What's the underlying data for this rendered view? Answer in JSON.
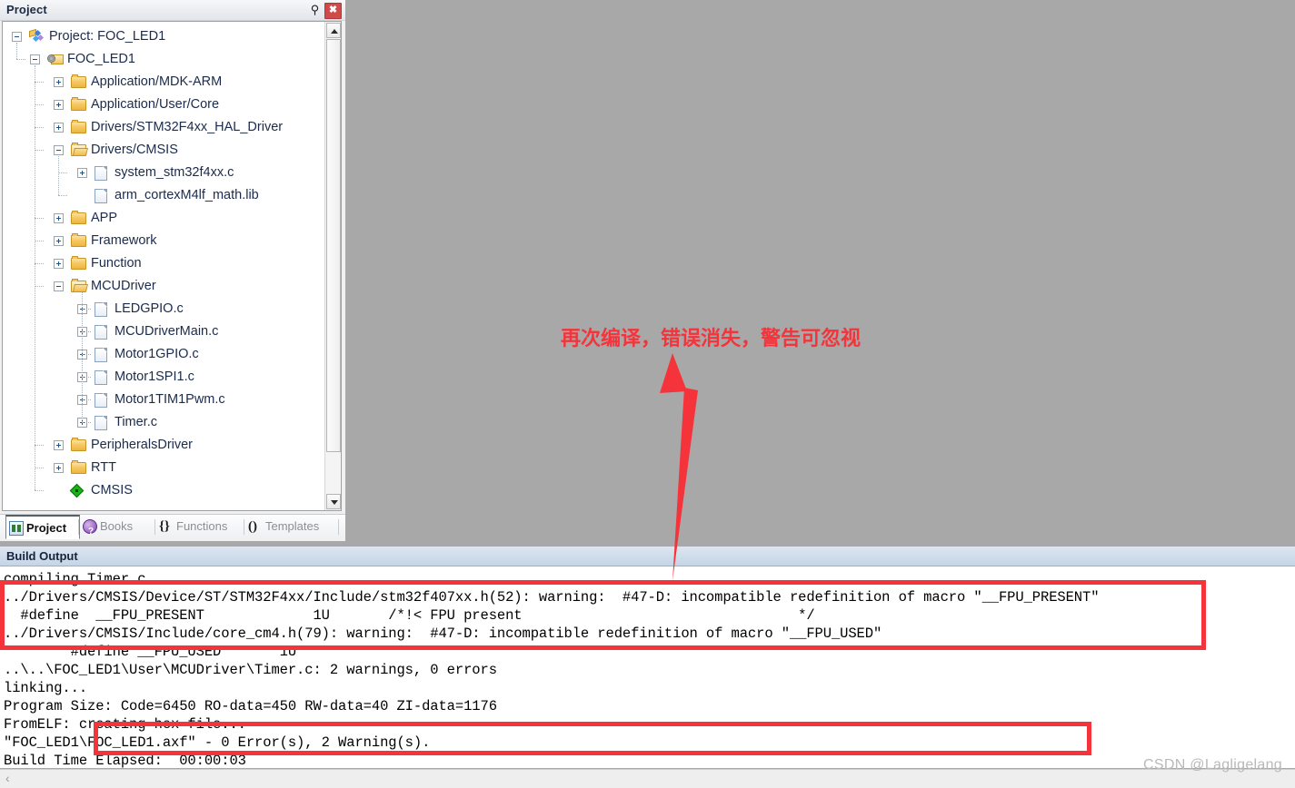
{
  "project_panel": {
    "title": "Project",
    "pin_icon": "pin-icon",
    "close_icon": "close-icon",
    "close_glyph": "✖",
    "pin_glyph": "⚲",
    "tree": [
      {
        "label": "Project: FOC_LED1",
        "depth": 0,
        "icon": "project-icon",
        "expander": "minus"
      },
      {
        "label": "FOC_LED1",
        "depth": 1,
        "icon": "target-icon",
        "expander": "minus"
      },
      {
        "label": "Application/MDK-ARM",
        "depth": 2,
        "icon": "folder-icon",
        "expander": "plus"
      },
      {
        "label": "Application/User/Core",
        "depth": 2,
        "icon": "folder-icon",
        "expander": "plus"
      },
      {
        "label": "Drivers/STM32F4xx_HAL_Driver",
        "depth": 2,
        "icon": "folder-icon",
        "expander": "plus"
      },
      {
        "label": "Drivers/CMSIS",
        "depth": 2,
        "icon": "folder-open-icon",
        "expander": "minus"
      },
      {
        "label": "system_stm32f4xx.c",
        "depth": 3,
        "icon": "file-icon",
        "expander": "plus"
      },
      {
        "label": "arm_cortexM4lf_math.lib",
        "depth": 3,
        "icon": "file-icon",
        "expander": "none"
      },
      {
        "label": "APP",
        "depth": 2,
        "icon": "folder-icon",
        "expander": "plus"
      },
      {
        "label": "Framework",
        "depth": 2,
        "icon": "folder-icon",
        "expander": "plus"
      },
      {
        "label": "Function",
        "depth": 2,
        "icon": "folder-icon",
        "expander": "plus"
      },
      {
        "label": "MCUDriver",
        "depth": 2,
        "icon": "folder-open-icon",
        "expander": "minus"
      },
      {
        "label": "LEDGPIO.c",
        "depth": 3,
        "icon": "file-icon",
        "expander": "plus"
      },
      {
        "label": "MCUDriverMain.c",
        "depth": 3,
        "icon": "file-icon",
        "expander": "plus"
      },
      {
        "label": "Motor1GPIO.c",
        "depth": 3,
        "icon": "file-icon",
        "expander": "plus"
      },
      {
        "label": "Motor1SPI1.c",
        "depth": 3,
        "icon": "file-icon",
        "expander": "plus"
      },
      {
        "label": "Motor1TIM1Pwm.c",
        "depth": 3,
        "icon": "file-icon",
        "expander": "plus"
      },
      {
        "label": "Timer.c",
        "depth": 3,
        "icon": "file-icon",
        "expander": "plus"
      },
      {
        "label": "PeripheralsDriver",
        "depth": 2,
        "icon": "folder-icon",
        "expander": "plus"
      },
      {
        "label": "RTT",
        "depth": 2,
        "icon": "folder-icon",
        "expander": "plus"
      },
      {
        "label": "CMSIS",
        "depth": 2,
        "icon": "green-diamond-icon",
        "expander": "none"
      }
    ],
    "tabs": [
      {
        "label": "Project",
        "icon": "project-tab-icon",
        "active": true
      },
      {
        "label": "Books",
        "icon": "books-tab-icon",
        "active": false
      },
      {
        "label": "Functions",
        "icon": "functions-tab-icon",
        "glyph": "{}",
        "active": false
      },
      {
        "label": "Templates",
        "icon": "templates-tab-icon",
        "glyph": "()",
        "active": false
      }
    ]
  },
  "build_output": {
    "title": "Build Output",
    "text": "compiling Timer.c...\n../Drivers/CMSIS/Device/ST/STM32F4xx/Include/stm32f407xx.h(52): warning:  #47-D: incompatible redefinition of macro \"__FPU_PRESENT\"\n  #define  __FPU_PRESENT             1U       /*!< FPU present                                 */\n../Drivers/CMSIS/Include/core_cm4.h(79): warning:  #47-D: incompatible redefinition of macro \"__FPU_USED\"\n        #define __FPU_USED       1U\n..\\..\\FOC_LED1\\User\\MCUDriver\\Timer.c: 2 warnings, 0 errors\nlinking...\nProgram Size: Code=6450 RO-data=450 RW-data=40 ZI-data=1176\nFromELF: creating hex file...\n\"FOC_LED1\\FOC_LED1.axf\" - 0 Error(s), 2 Warning(s).\nBuild Time Elapsed:  00:00:03",
    "hscroll_left_glyph": "‹"
  },
  "annotation": {
    "note": "再次编译，错误消失，警告可忽视",
    "color": "#f5333a",
    "arrow_icon": "up-arrow-icon",
    "boxes": [
      {
        "name": "warning-highlight-box"
      },
      {
        "name": "result-highlight-box"
      }
    ]
  },
  "watermark": {
    "text": "CSDN @Lagligelang"
  }
}
